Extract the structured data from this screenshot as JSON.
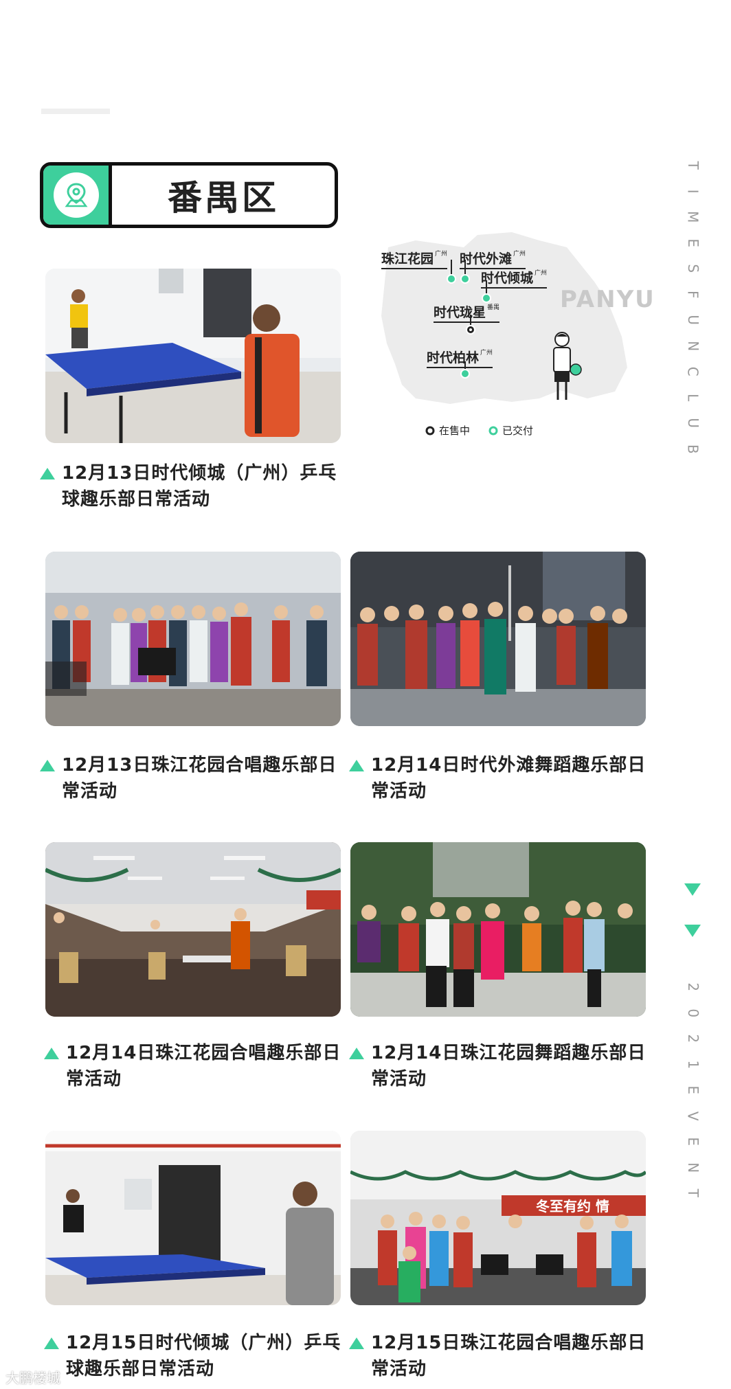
{
  "district": {
    "name": "番禺区",
    "icon": "map-pin-icon"
  },
  "map": {
    "watermark_text": "PANYU",
    "projects": [
      {
        "name": "珠江花园",
        "city": "广州"
      },
      {
        "name": "时代外滩",
        "city": "广州"
      },
      {
        "name": "时代倾城",
        "city": "广州"
      },
      {
        "name": "时代珑星",
        "city": "番禺"
      },
      {
        "name": "时代柏林",
        "city": "广州"
      }
    ],
    "legend": [
      {
        "label": "在售中",
        "color": "#222222"
      },
      {
        "label": "已交付",
        "color": "#3ecf9c"
      }
    ]
  },
  "side_text": {
    "top": [
      "T",
      "I",
      "M",
      "E",
      "S",
      "F",
      "U",
      "N",
      "C",
      "L",
      "U",
      "B"
    ],
    "bottom": [
      "2",
      "0",
      "2",
      "1",
      "E",
      "V",
      "E",
      "N",
      "T"
    ]
  },
  "events": [
    {
      "caption": "12月13日时代倾城（广州）乒乓球趣乐部日常活动",
      "photo": "table-tennis-photo"
    },
    {
      "caption": "12月13日珠江花园合唱趣乐部日常活动",
      "photo": "choir-group-photo"
    },
    {
      "caption": "12月14日时代外滩舞蹈趣乐部日常活动",
      "photo": "dance-group-photo"
    },
    {
      "caption": "12月14日珠江花园合唱趣乐部日常活动",
      "photo": "choir-hall-photo"
    },
    {
      "caption": "12月14日珠江花园舞蹈趣乐部日常活动",
      "photo": "outdoor-dance-photo"
    },
    {
      "caption": "12月15日时代倾城（广州）乒乓球趣乐部日常活动",
      "photo": "table-tennis-photo"
    },
    {
      "caption": "12月15日珠江花园合唱趣乐部日常活动",
      "photo": "choir-banner-photo"
    }
  ],
  "banner_text": "冬至有约 情",
  "watermark": "大鹏楼城"
}
